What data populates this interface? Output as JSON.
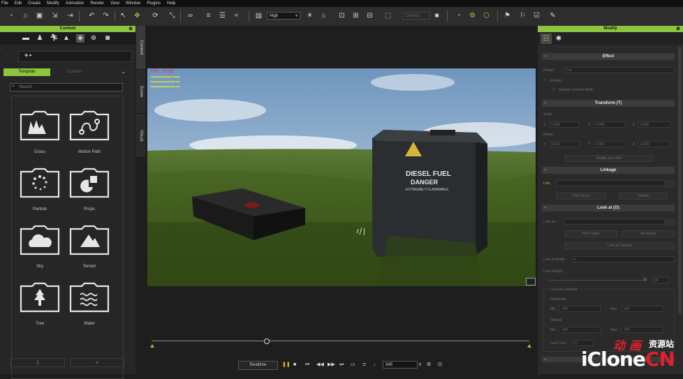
{
  "menu": [
    "File",
    "Edit",
    "Create",
    "Modify",
    "Animation",
    "Render",
    "View",
    "Window",
    "Plugins",
    "Help"
  ],
  "toolbar": {
    "quality": "High",
    "camera_placeholder": "Camera"
  },
  "left_panel": {
    "title": "Content",
    "tabs": [
      "Template",
      "Custom"
    ],
    "search_placeholder": "Search",
    "items": [
      {
        "label": "Grass",
        "icon": "grass-icon"
      },
      {
        "label": "Motion Path",
        "icon": "motion-path-icon"
      },
      {
        "label": "Particle",
        "icon": "particle-icon"
      },
      {
        "label": "Props",
        "icon": "props-icon"
      },
      {
        "label": "Sky",
        "icon": "sky-icon"
      },
      {
        "label": "Terrain",
        "icon": "terrain-icon"
      },
      {
        "label": "Tree",
        "icon": "tree-icon"
      },
      {
        "label": "Water",
        "icon": "water-icon"
      }
    ]
  },
  "side_tabs": [
    "Content",
    "Scene",
    "Visual"
  ],
  "viewport": {
    "fps": "FPS : 13.05",
    "scene_text": {
      "can_line1": "DIESEL FUEL",
      "can_line2": "DANGER",
      "can_line3": "EXTREMELY FLAMMABLE"
    }
  },
  "playback": {
    "realtime_label": "Realtime",
    "frame": "545"
  },
  "right_panel": {
    "title": "Modify",
    "sections": {
      "effect": {
        "title": "Effect",
        "preset_label": "Preset:",
        "preset_value": "Fur",
        "enable_label": "Enable",
        "smooth_label": "Indicate Smooth Mode"
      },
      "transform": {
        "title": "Transform (T)",
        "scale_label": "Scale",
        "rotate_label": "Rotate",
        "reset_label": "Modify Zero Rot",
        "scale_values": [
          "0.000",
          "0.000",
          "0.000"
        ],
        "rotate_values": [
          "0.000",
          "0.000",
          "0.000"
        ],
        "axes": [
          "X",
          "Y",
          "Z"
        ]
      },
      "linkage": {
        "title": "Linkage",
        "link_label": "Link:",
        "pick_parent": "Pick Parent",
        "detach": "Detach"
      },
      "lookat": {
        "title": "Look at (O)",
        "lookat_label": "Look at:",
        "pick_target": "Pick Target",
        "set_active": "Set Active",
        "look_at_camera": "Look at Camera",
        "look_at_mode_label": "Look at Mode:",
        "look_weight_label": "Look Weight",
        "weight_value": "80",
        "limitation_label": "Look At Limitation",
        "horizontal_label": "Horizontal",
        "vertical_label": "Vertical",
        "min_label": "Min",
        "max_label": "Max",
        "h_min": "-100",
        "h_max": "100",
        "v_min": "-100",
        "v_max": "100",
        "look_time_label": "Look Time",
        "look_time_value": "0"
      }
    }
  },
  "watermark": {
    "cn": "动 画",
    "cn2": "资源站",
    "brand_a": "iClone",
    "brand_b": "CN"
  },
  "colors": {
    "accent": "#8cc63f",
    "panel": "#262626",
    "fps": "#ff2255"
  }
}
